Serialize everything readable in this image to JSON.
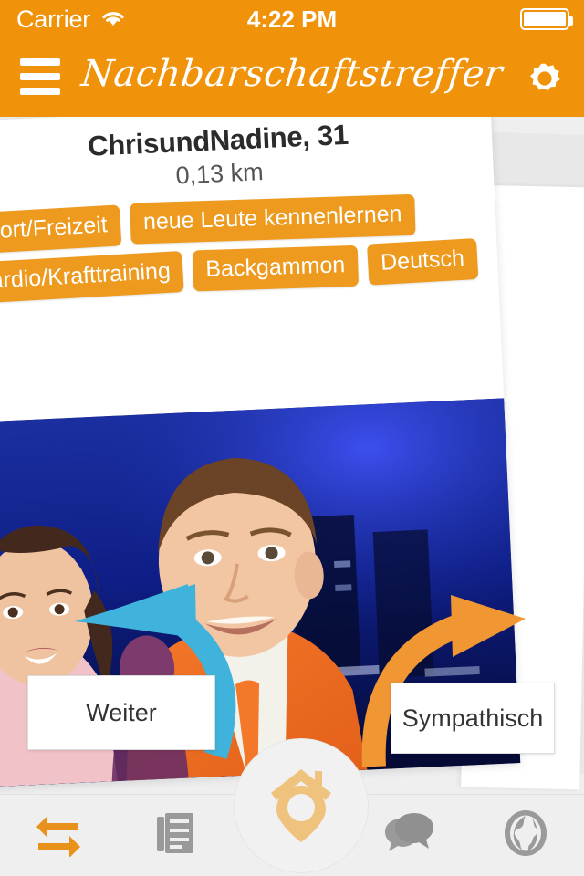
{
  "status_bar": {
    "carrier": "Carrier",
    "time": "4:22 PM",
    "wifi_icon": "wifi-icon",
    "battery_icon": "battery-full-icon"
  },
  "nav_bar": {
    "title": "Nachbarschaftstreffer",
    "menu_icon": "hamburger-menu-icon",
    "settings_icon": "gear-icon"
  },
  "profile_card": {
    "name": "ChrisundNadine, 31",
    "distance": "0,13 km",
    "tags": [
      "Sport/Freizeit",
      "neue Leute kennenlernen",
      "Cardio/Krafttraining",
      "Backgammon",
      "Deutsch"
    ],
    "photo_alt": "couple-photo"
  },
  "actions": {
    "reject": {
      "label": "Weiter",
      "arrow_icon": "curved-arrow-left-icon",
      "arrow_color": "#3FB3DC"
    },
    "accept": {
      "label": "Sympathisch",
      "arrow_icon": "curved-arrow-right-icon",
      "arrow_color": "#F09633"
    }
  },
  "tab_bar": {
    "items": [
      {
        "name": "swap-arrows-icon",
        "active": true
      },
      {
        "name": "list-document-icon",
        "active": false
      },
      {
        "name": "map-pin-house-icon",
        "active": false
      },
      {
        "name": "chat-bubbles-icon",
        "active": false
      },
      {
        "name": "globe-icon",
        "active": false
      }
    ]
  },
  "colors": {
    "brand_orange": "#F0930A",
    "tag_orange": "#ED9A1E",
    "accept_arrow": "#F09633",
    "reject_arrow": "#3FB3DC",
    "pin_tan": "#EFC37E",
    "tab_inactive": "#9a9a9a",
    "background": "#efefef"
  }
}
